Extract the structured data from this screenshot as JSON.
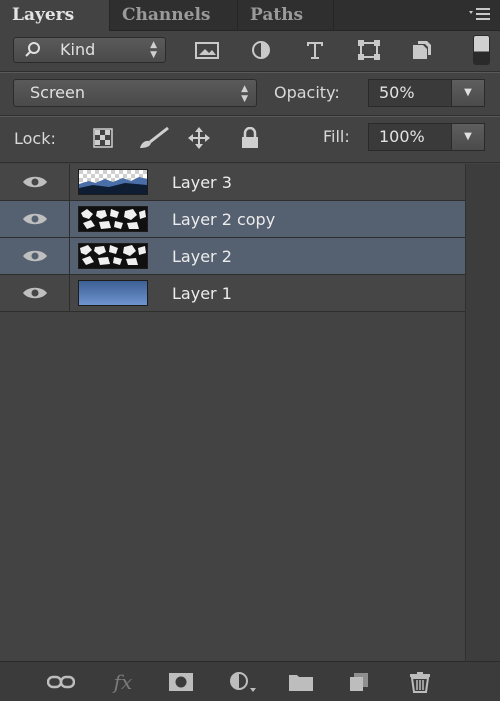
{
  "tabs": [
    {
      "label": "Layers",
      "active": true
    },
    {
      "label": "Channels",
      "active": false
    },
    {
      "label": "Paths",
      "active": false
    }
  ],
  "panel_menu_icon": "panel-menu-icon",
  "filter": {
    "kind_label": "Kind",
    "icons": [
      "image-filter-icon",
      "adjustment-filter-icon",
      "type-filter-icon",
      "shape-filter-icon",
      "smart-object-filter-icon"
    ]
  },
  "blend": {
    "mode": "Screen",
    "opacity_label": "Opacity:",
    "opacity_value": "50%"
  },
  "lock": {
    "label": "Lock:",
    "icons": [
      "lock-transparent-pixels-icon",
      "lock-image-pixels-icon",
      "lock-position-icon",
      "lock-all-icon"
    ],
    "fill_label": "Fill:",
    "fill_value": "100%"
  },
  "layers": [
    {
      "name": "Layer 3",
      "visible": true,
      "selected": false
    },
    {
      "name": "Layer 2 copy",
      "visible": true,
      "selected": true
    },
    {
      "name": "Layer 2",
      "visible": true,
      "selected": true
    },
    {
      "name": "Layer 1",
      "visible": true,
      "selected": false
    }
  ],
  "footer_icons": [
    "link-layers-icon",
    "fx-icon",
    "add-mask-icon",
    "adjustment-layer-icon",
    "group-folder-icon",
    "new-layer-icon",
    "trash-icon"
  ],
  "colors": {
    "panel_bg": "#434343",
    "selected_row": "#556070",
    "tab_bar": "#2f2f2f"
  }
}
